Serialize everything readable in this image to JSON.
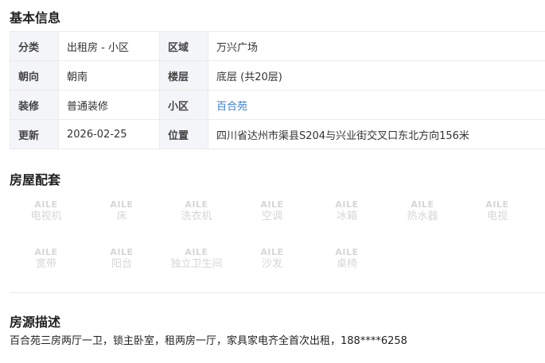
{
  "sections": {
    "basic_title": "基本信息",
    "amenities_title": "房屋配套",
    "description_title": "房源描述"
  },
  "basic_info": {
    "rows": [
      {
        "k1": "分类",
        "v1": "出租房 - 小区",
        "k2": "区域",
        "v2": "万兴广场"
      },
      {
        "k1": "朝向",
        "v1": "朝南",
        "k2": "楼层",
        "v2": "底层 (共20层)"
      },
      {
        "k1": "装修",
        "v1": "普通装修",
        "k2": "小区",
        "v2": "百合苑"
      },
      {
        "k1": "更新",
        "v1": "2026-02-25",
        "k2": "位置",
        "v2": "四川省达州市渠县S204与兴业街交叉口东北方向156米"
      }
    ]
  },
  "amenities": {
    "watermark": "AILE",
    "items": [
      "电视机",
      "床",
      "洗衣机",
      "空调",
      "冰箱",
      "热水器",
      "电视",
      "宽带",
      "阳台",
      "独立卫生间",
      "沙发",
      "桌椅"
    ]
  },
  "description": {
    "text": "百合苑三房两厅一卫，锁主卧室，租两房一厅，家具家电齐全首次出租，188****6258"
  },
  "colors": {
    "link": "#3a7bd5",
    "key_bg": "#f4f5f9",
    "amenity_disabled": "#d6d6d6"
  }
}
